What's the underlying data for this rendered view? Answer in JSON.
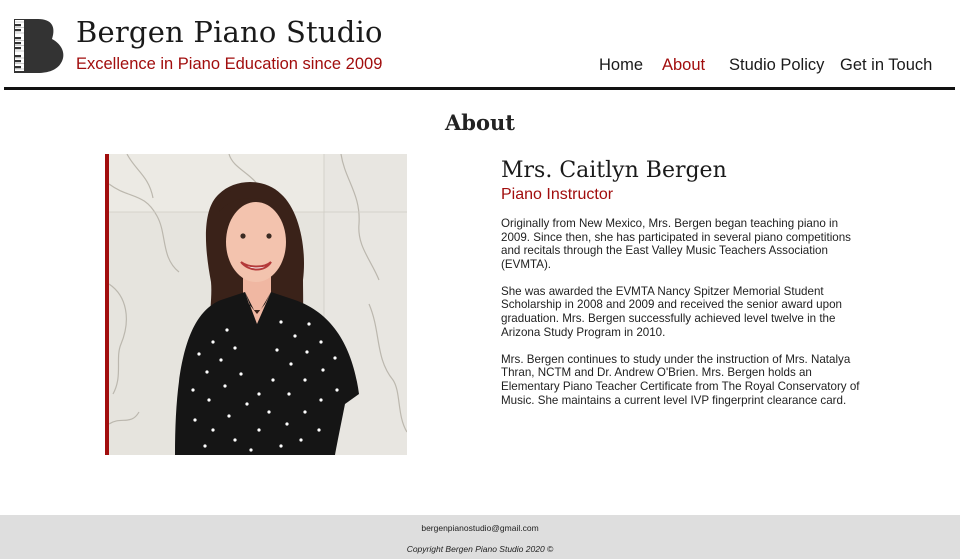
{
  "header": {
    "title": "Bergen Piano Studio",
    "tagline": "Excellence in Piano Education since 2009",
    "logo_icon": "grand-piano-icon"
  },
  "nav": {
    "items": [
      {
        "label": "Home"
      },
      {
        "label": "About",
        "active": true
      },
      {
        "label": "Studio Policy"
      },
      {
        "label": "Get in Touch"
      }
    ]
  },
  "colors": {
    "accent": "#a10d0d",
    "text": "#1a1a1a",
    "footer_bg": "#dedede"
  },
  "page": {
    "title": "About"
  },
  "profile": {
    "name": "Mrs. Caitlyn Bergen",
    "role": "Piano Instructor",
    "bio": [
      "Originally from New Mexico, Mrs. Bergen began teaching piano in 2009. Since then, she has participated in several piano competitions and recitals through the East Valley Music Teachers Association (EVMTA).",
      "She was awarded the EVMTA Nancy Spitzer Memorial Student Scholarship in 2008 and 2009 and received the senior award upon graduation. Mrs. Bergen successfully achieved level twelve in the Arizona Study Program in 2010.",
      "Mrs. Bergen continues to study under the instruction of Mrs. Natalya Thran, NCTM and Dr. Andrew O'Brien. Mrs. Bergen holds an Elementary Piano Teacher Certificate from The Royal Conservatory of Music. She maintains a current level IVP fingerprint clearance card."
    ]
  },
  "footer": {
    "email": "bergenpianostudio@gmail.com",
    "copyright": "Copyright Bergen Piano Studio 2020 ©"
  }
}
